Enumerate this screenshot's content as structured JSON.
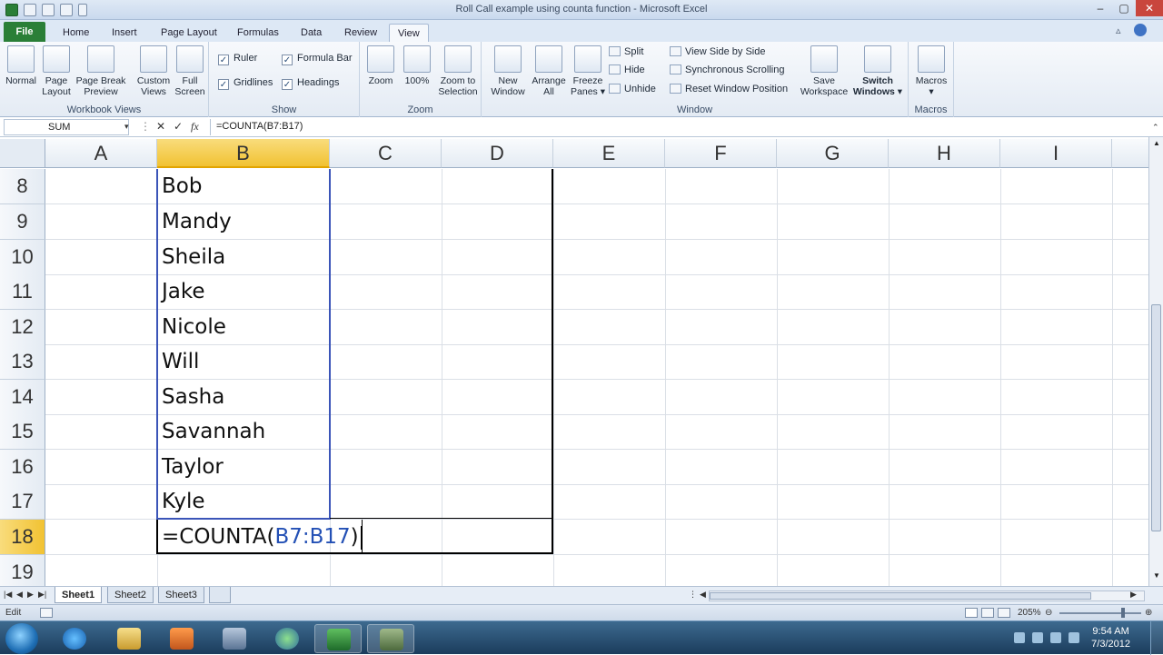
{
  "window": {
    "title": "Roll Call example using counta function - Microsoft Excel",
    "controls": {
      "minimize": "–",
      "maximize": "▢",
      "close": "✕"
    }
  },
  "ribbon_tabs": [
    "File",
    "Home",
    "Insert",
    "Page Layout",
    "Formulas",
    "Data",
    "Review",
    "View"
  ],
  "active_tab": "View",
  "ribbon": {
    "workbook_views": {
      "label": "Workbook Views",
      "buttons": [
        {
          "line1": "Normal",
          "line2": ""
        },
        {
          "line1": "Page",
          "line2": "Layout"
        },
        {
          "line1": "Page Break",
          "line2": "Preview"
        },
        {
          "line1": "Custom",
          "line2": "Views"
        },
        {
          "line1": "Full",
          "line2": "Screen"
        }
      ]
    },
    "show": {
      "label": "Show",
      "ruler": "Ruler",
      "formula_bar": "Formula Bar",
      "gridlines": "Gridlines",
      "headings": "Headings"
    },
    "zoom": {
      "label": "Zoom",
      "buttons": [
        {
          "line1": "Zoom",
          "line2": ""
        },
        {
          "line1": "100%",
          "line2": ""
        },
        {
          "line1": "Zoom to",
          "line2": "Selection"
        }
      ]
    },
    "window": {
      "label": "Window",
      "new_window": {
        "line1": "New",
        "line2": "Window"
      },
      "arrange_all": {
        "line1": "Arrange",
        "line2": "All"
      },
      "freeze_panes": {
        "line1": "Freeze",
        "line2": "Panes ▾"
      },
      "split": "Split",
      "hide": "Hide",
      "unhide": "Unhide",
      "view_side_by_side": "View Side by Side",
      "synchronous_scrolling": "Synchronous Scrolling",
      "reset_window_position": "Reset Window Position",
      "save_workspace": {
        "line1": "Save",
        "line2": "Workspace"
      },
      "switch_windows": {
        "line1": "Switch",
        "line2": "Windows ▾"
      }
    },
    "macros": {
      "label": "Macros",
      "button": {
        "line1": "Macros",
        "line2": "▾"
      }
    }
  },
  "formula_bar": {
    "name_box": "SUM",
    "cancel_icon": "✕",
    "enter_icon": "✓",
    "fx": "fx",
    "formula": "=COUNTA(B7:B17)"
  },
  "columns": [
    "A",
    "B",
    "C",
    "D",
    "E",
    "F",
    "G",
    "H",
    "I"
  ],
  "selected_column": "B",
  "rows": [
    {
      "num": "8",
      "b": "Bob"
    },
    {
      "num": "9",
      "b": "Mandy"
    },
    {
      "num": "10",
      "b": "Sheila"
    },
    {
      "num": "11",
      "b": "Jake"
    },
    {
      "num": "12",
      "b": "Nicole"
    },
    {
      "num": "13",
      "b": "Will"
    },
    {
      "num": "14",
      "b": "Sasha"
    },
    {
      "num": "15",
      "b": "Savannah"
    },
    {
      "num": "16",
      "b": "Taylor"
    },
    {
      "num": "17",
      "b": "Kyle"
    },
    {
      "num": "18",
      "b": ""
    },
    {
      "num": "19",
      "b": ""
    }
  ],
  "editing_cell": {
    "row": "18",
    "prefix": "=COUNTA(",
    "ref": "B7:B17",
    "suffix": ")"
  },
  "sheet_tabs": [
    "Sheet1",
    "Sheet2",
    "Sheet3"
  ],
  "active_sheet": "Sheet1",
  "status": {
    "mode": "Edit",
    "zoom": "205%"
  },
  "taskbar": {
    "time": "9:54 AM",
    "date": "7/3/2012"
  },
  "colors": {
    "file_tab": "#2a7f37",
    "selected_header": "#f1c232",
    "range_ref": "#2350b5"
  }
}
